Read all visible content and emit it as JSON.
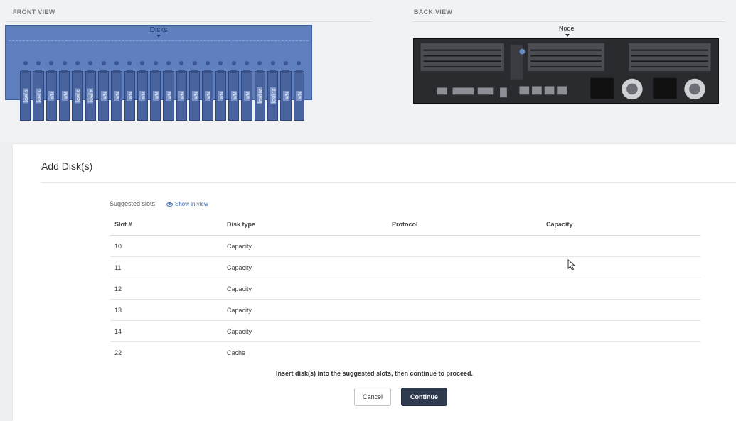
{
  "front_view": {
    "title": "FRONT VIEW",
    "chassis_label": "Disks",
    "slots": [
      "0 [BO]",
      "1 [BO]",
      "N/A",
      "N/A",
      "3 [BO]",
      "4 [BO]",
      "N/A",
      "N/A",
      "N/A",
      "N/A",
      "N/A",
      "N/A",
      "N/A",
      "N/A",
      "N/A",
      "N/A",
      "N/A",
      "N/A",
      "20 [BO]",
      "21 [BO]",
      "N/A",
      "N/A"
    ]
  },
  "back_view": {
    "title": "BACK VIEW",
    "chassis_label": "Node"
  },
  "dialog": {
    "title": "Add Disk(s)",
    "suggested_label": "Suggested slots",
    "show_in_view": "Show in view",
    "columns": [
      "Slot #",
      "Disk type",
      "Protocol",
      "Capacity"
    ],
    "rows": [
      {
        "slot": "10",
        "type": "Capacity",
        "protocol": "",
        "capacity": ""
      },
      {
        "slot": "11",
        "type": "Capacity",
        "protocol": "",
        "capacity": ""
      },
      {
        "slot": "12",
        "type": "Capacity",
        "protocol": "",
        "capacity": ""
      },
      {
        "slot": "13",
        "type": "Capacity",
        "protocol": "",
        "capacity": ""
      },
      {
        "slot": "14",
        "type": "Capacity",
        "protocol": "",
        "capacity": ""
      },
      {
        "slot": "22",
        "type": "Cache",
        "protocol": "",
        "capacity": ""
      }
    ],
    "instruction": "Insert disk(s) into the suggested slots, then continue to proceed.",
    "cancel_label": "Cancel",
    "continue_label": "Continue"
  },
  "colors": {
    "front_chassis": "#5f7fbf",
    "continue_button": "#2f3a4f",
    "link": "#3b6db3"
  }
}
